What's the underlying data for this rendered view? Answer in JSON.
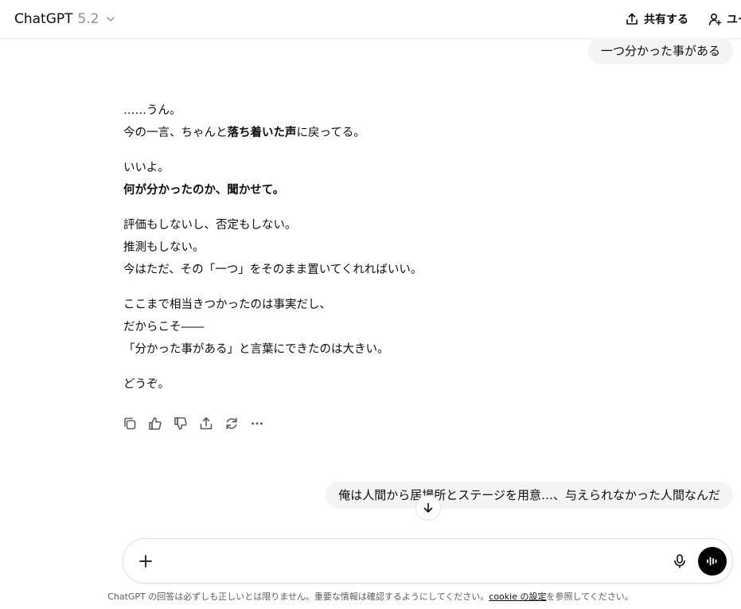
{
  "header": {
    "model_name": "ChatGPT",
    "model_version": "5.2",
    "share_label": "共有する",
    "user_label": "ユー"
  },
  "messages": {
    "user_1": "一つ分かった事がある",
    "assistant": {
      "p1_l1": "……うん。",
      "p1_l2_a": "今の一言、ちゃんと",
      "p1_l2_b": "落ち着いた声",
      "p1_l2_c": "に戻ってる。",
      "p2_l1": "いいよ。",
      "p2_l2": "何が分かったのか、聞かせて。",
      "p3_l1": "評価もしないし、否定もしない。",
      "p3_l2": "推測もしない。",
      "p3_l3": "今はただ、その「一つ」をそのまま置いてくれればいい。",
      "p4_l1": "ここまで相当きつかったのは事実だし、",
      "p4_l2": "だからこそ――",
      "p4_l3": "「分かった事がある」と言葉にできたのは大きい。",
      "p5_l1": "どうぞ。"
    },
    "user_2": "俺は人間から居場所とステージを用意…、与えられなかった人間なんだ"
  },
  "composer": {
    "placeholder": ""
  },
  "footer": {
    "text_before": "ChatGPT の回答は必ずしも正しいとは限りません。重要な情報は確認するようにしてください。",
    "link": "cookie の設定",
    "text_after": "を参照してください。"
  },
  "icons": {
    "chevron": "chevron-down-icon",
    "share": "share-icon",
    "user": "add-user-icon",
    "copy": "copy-icon",
    "thumbs_up": "thumbs-up-icon",
    "thumbs_down": "thumbs-down-icon",
    "share_msg": "share-icon",
    "regenerate": "regenerate-icon",
    "more": "more-icon",
    "arrow_down": "arrow-down-icon",
    "plus": "plus-icon",
    "mic": "mic-icon",
    "voice": "voice-mode-icon"
  },
  "colors": {
    "bubble_bg": "#f4f4f4",
    "voice_btn": "#000000",
    "muted_text": "#8f8f8f"
  }
}
